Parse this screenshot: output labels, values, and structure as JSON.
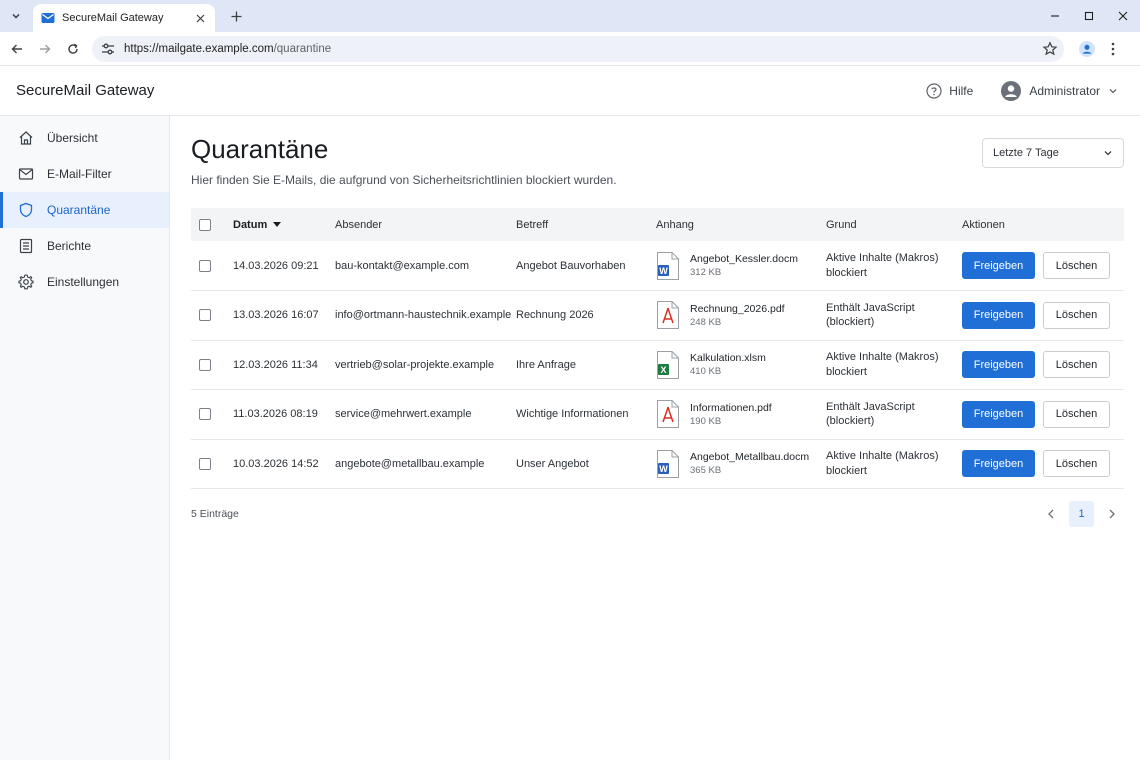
{
  "browser": {
    "tab_title": "SecureMail Gateway",
    "url_host": "https://mailgate.example.com",
    "url_path": "/quarantine"
  },
  "header": {
    "brand": "SecureMail Gateway",
    "help_label": "Hilfe",
    "user_label": "Administrator"
  },
  "sidebar": {
    "items": [
      {
        "label": "Übersicht",
        "icon": "home-icon"
      },
      {
        "label": "E-Mail-Filter",
        "icon": "mail-icon"
      },
      {
        "label": "Quarantäne",
        "icon": "shield-icon",
        "active": true
      },
      {
        "label": "Berichte",
        "icon": "report-icon"
      },
      {
        "label": "Einstellungen",
        "icon": "gear-icon"
      }
    ]
  },
  "page": {
    "title": "Quarantäne",
    "subtitle": "Hier finden Sie E-Mails, die aufgrund von Sicherheitsrichtlinien blockiert wurden.",
    "range_select": "Letzte 7 Tage"
  },
  "table": {
    "headers": {
      "date": "Datum",
      "sender": "Absender",
      "subject": "Betreff",
      "attachment": "Anhang",
      "reason": "Grund",
      "actions": "Aktionen"
    },
    "release_label": "Freigeben",
    "delete_label": "Löschen",
    "rows": [
      {
        "date": "14.03.2026 09:21",
        "sender": "bau-kontakt@example.com",
        "subject": "Angebot Bauvorhaben",
        "file": "Angebot_Kessler.docm",
        "size": "312 KB",
        "type": "word",
        "reason1": "Aktive Inhalte (Makros)",
        "reason2": "blockiert"
      },
      {
        "date": "13.03.2026 16:07",
        "sender": "info@ortmann-haustechnik.example",
        "subject": "Rechnung 2026",
        "file": "Rechnung_2026.pdf",
        "size": "248 KB",
        "type": "pdf",
        "reason1": "Enthält JavaScript",
        "reason2": "(blockiert)"
      },
      {
        "date": "12.03.2026 11:34",
        "sender": "vertrieb@solar-projekte.example",
        "subject": "Ihre Anfrage",
        "file": "Kalkulation.xlsm",
        "size": "410 KB",
        "type": "excel",
        "reason1": "Aktive Inhalte (Makros)",
        "reason2": "blockiert"
      },
      {
        "date": "11.03.2026 08:19",
        "sender": "service@mehrwert.example",
        "subject": "Wichtige Informationen",
        "file": "Informationen.pdf",
        "size": "190 KB",
        "type": "pdf",
        "reason1": "Enthält JavaScript",
        "reason2": "(blockiert)"
      },
      {
        "date": "10.03.2026 14:52",
        "sender": "angebote@metallbau.example",
        "subject": "Unser Angebot",
        "file": "Angebot_Metallbau.docm",
        "size": "365 KB",
        "type": "word",
        "reason1": "Aktive Inhalte (Makros)",
        "reason2": "blockiert"
      }
    ]
  },
  "footer": {
    "count": "5 Einträge",
    "page": "1"
  },
  "colors": {
    "accent": "#1f6fd6",
    "word": "#2b5fb8",
    "pdf": "#d93025",
    "excel": "#1e7a43"
  }
}
